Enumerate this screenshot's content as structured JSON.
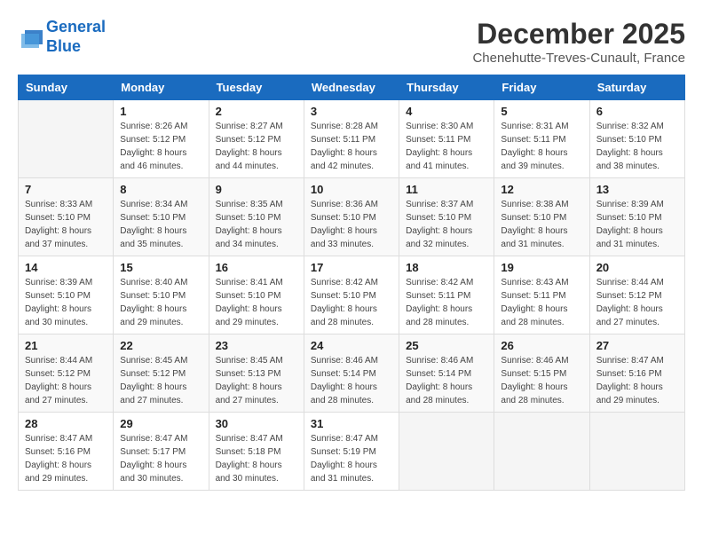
{
  "header": {
    "logo_line1": "General",
    "logo_line2": "Blue",
    "month": "December 2025",
    "location": "Chenehutte-Treves-Cunault, France"
  },
  "weekdays": [
    "Sunday",
    "Monday",
    "Tuesday",
    "Wednesday",
    "Thursday",
    "Friday",
    "Saturday"
  ],
  "weeks": [
    [
      {
        "day": "",
        "sunrise": "",
        "sunset": "",
        "daylight": ""
      },
      {
        "day": "1",
        "sunrise": "Sunrise: 8:26 AM",
        "sunset": "Sunset: 5:12 PM",
        "daylight": "Daylight: 8 hours and 46 minutes."
      },
      {
        "day": "2",
        "sunrise": "Sunrise: 8:27 AM",
        "sunset": "Sunset: 5:12 PM",
        "daylight": "Daylight: 8 hours and 44 minutes."
      },
      {
        "day": "3",
        "sunrise": "Sunrise: 8:28 AM",
        "sunset": "Sunset: 5:11 PM",
        "daylight": "Daylight: 8 hours and 42 minutes."
      },
      {
        "day": "4",
        "sunrise": "Sunrise: 8:30 AM",
        "sunset": "Sunset: 5:11 PM",
        "daylight": "Daylight: 8 hours and 41 minutes."
      },
      {
        "day": "5",
        "sunrise": "Sunrise: 8:31 AM",
        "sunset": "Sunset: 5:11 PM",
        "daylight": "Daylight: 8 hours and 39 minutes."
      },
      {
        "day": "6",
        "sunrise": "Sunrise: 8:32 AM",
        "sunset": "Sunset: 5:10 PM",
        "daylight": "Daylight: 8 hours and 38 minutes."
      }
    ],
    [
      {
        "day": "7",
        "sunrise": "Sunrise: 8:33 AM",
        "sunset": "Sunset: 5:10 PM",
        "daylight": "Daylight: 8 hours and 37 minutes."
      },
      {
        "day": "8",
        "sunrise": "Sunrise: 8:34 AM",
        "sunset": "Sunset: 5:10 PM",
        "daylight": "Daylight: 8 hours and 35 minutes."
      },
      {
        "day": "9",
        "sunrise": "Sunrise: 8:35 AM",
        "sunset": "Sunset: 5:10 PM",
        "daylight": "Daylight: 8 hours and 34 minutes."
      },
      {
        "day": "10",
        "sunrise": "Sunrise: 8:36 AM",
        "sunset": "Sunset: 5:10 PM",
        "daylight": "Daylight: 8 hours and 33 minutes."
      },
      {
        "day": "11",
        "sunrise": "Sunrise: 8:37 AM",
        "sunset": "Sunset: 5:10 PM",
        "daylight": "Daylight: 8 hours and 32 minutes."
      },
      {
        "day": "12",
        "sunrise": "Sunrise: 8:38 AM",
        "sunset": "Sunset: 5:10 PM",
        "daylight": "Daylight: 8 hours and 31 minutes."
      },
      {
        "day": "13",
        "sunrise": "Sunrise: 8:39 AM",
        "sunset": "Sunset: 5:10 PM",
        "daylight": "Daylight: 8 hours and 31 minutes."
      }
    ],
    [
      {
        "day": "14",
        "sunrise": "Sunrise: 8:39 AM",
        "sunset": "Sunset: 5:10 PM",
        "daylight": "Daylight: 8 hours and 30 minutes."
      },
      {
        "day": "15",
        "sunrise": "Sunrise: 8:40 AM",
        "sunset": "Sunset: 5:10 PM",
        "daylight": "Daylight: 8 hours and 29 minutes."
      },
      {
        "day": "16",
        "sunrise": "Sunrise: 8:41 AM",
        "sunset": "Sunset: 5:10 PM",
        "daylight": "Daylight: 8 hours and 29 minutes."
      },
      {
        "day": "17",
        "sunrise": "Sunrise: 8:42 AM",
        "sunset": "Sunset: 5:10 PM",
        "daylight": "Daylight: 8 hours and 28 minutes."
      },
      {
        "day": "18",
        "sunrise": "Sunrise: 8:42 AM",
        "sunset": "Sunset: 5:11 PM",
        "daylight": "Daylight: 8 hours and 28 minutes."
      },
      {
        "day": "19",
        "sunrise": "Sunrise: 8:43 AM",
        "sunset": "Sunset: 5:11 PM",
        "daylight": "Daylight: 8 hours and 28 minutes."
      },
      {
        "day": "20",
        "sunrise": "Sunrise: 8:44 AM",
        "sunset": "Sunset: 5:12 PM",
        "daylight": "Daylight: 8 hours and 27 minutes."
      }
    ],
    [
      {
        "day": "21",
        "sunrise": "Sunrise: 8:44 AM",
        "sunset": "Sunset: 5:12 PM",
        "daylight": "Daylight: 8 hours and 27 minutes."
      },
      {
        "day": "22",
        "sunrise": "Sunrise: 8:45 AM",
        "sunset": "Sunset: 5:12 PM",
        "daylight": "Daylight: 8 hours and 27 minutes."
      },
      {
        "day": "23",
        "sunrise": "Sunrise: 8:45 AM",
        "sunset": "Sunset: 5:13 PM",
        "daylight": "Daylight: 8 hours and 27 minutes."
      },
      {
        "day": "24",
        "sunrise": "Sunrise: 8:46 AM",
        "sunset": "Sunset: 5:14 PM",
        "daylight": "Daylight: 8 hours and 28 minutes."
      },
      {
        "day": "25",
        "sunrise": "Sunrise: 8:46 AM",
        "sunset": "Sunset: 5:14 PM",
        "daylight": "Daylight: 8 hours and 28 minutes."
      },
      {
        "day": "26",
        "sunrise": "Sunrise: 8:46 AM",
        "sunset": "Sunset: 5:15 PM",
        "daylight": "Daylight: 8 hours and 28 minutes."
      },
      {
        "day": "27",
        "sunrise": "Sunrise: 8:47 AM",
        "sunset": "Sunset: 5:16 PM",
        "daylight": "Daylight: 8 hours and 29 minutes."
      }
    ],
    [
      {
        "day": "28",
        "sunrise": "Sunrise: 8:47 AM",
        "sunset": "Sunset: 5:16 PM",
        "daylight": "Daylight: 8 hours and 29 minutes."
      },
      {
        "day": "29",
        "sunrise": "Sunrise: 8:47 AM",
        "sunset": "Sunset: 5:17 PM",
        "daylight": "Daylight: 8 hours and 30 minutes."
      },
      {
        "day": "30",
        "sunrise": "Sunrise: 8:47 AM",
        "sunset": "Sunset: 5:18 PM",
        "daylight": "Daylight: 8 hours and 30 minutes."
      },
      {
        "day": "31",
        "sunrise": "Sunrise: 8:47 AM",
        "sunset": "Sunset: 5:19 PM",
        "daylight": "Daylight: 8 hours and 31 minutes."
      },
      {
        "day": "",
        "sunrise": "",
        "sunset": "",
        "daylight": ""
      },
      {
        "day": "",
        "sunrise": "",
        "sunset": "",
        "daylight": ""
      },
      {
        "day": "",
        "sunrise": "",
        "sunset": "",
        "daylight": ""
      }
    ]
  ]
}
